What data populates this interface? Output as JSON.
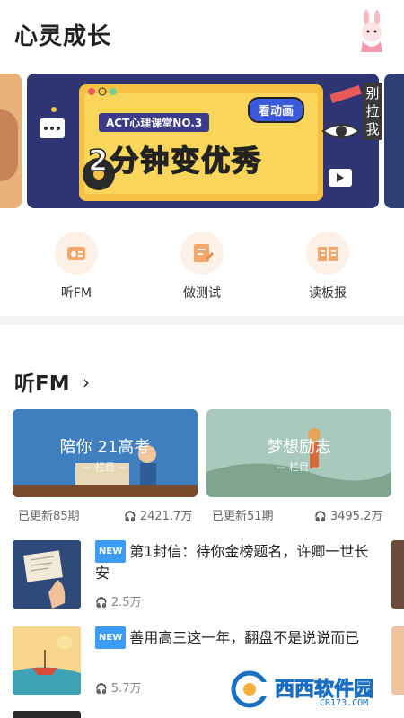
{
  "page": {
    "title": "心灵成长"
  },
  "banner": {
    "course_label": "ACT心理课堂NO.3",
    "watch_label": "看动画",
    "headline": "2分钟变优秀",
    "side_tab": "别拉我"
  },
  "quick_actions": [
    {
      "label": "听FM",
      "icon": "radio-icon"
    },
    {
      "label": "做测试",
      "icon": "test-icon"
    },
    {
      "label": "读板报",
      "icon": "book-icon"
    }
  ],
  "fm_section": {
    "title": "听FM",
    "cards": [
      {
        "title": "陪你 21高考",
        "sub": "— 栏目 —",
        "updated": "已更新85期",
        "plays": "2421.7万"
      },
      {
        "title": "梦想励志",
        "sub": "— 栏目 —",
        "updated": "已更新51期",
        "plays": "3495.2万"
      }
    ],
    "items": [
      {
        "badge": "NEW",
        "title": "第1封信：待你金榜题名，许卿一世长安",
        "plays": "2.5万"
      },
      {
        "badge": "NEW",
        "title": "善用高三这一年，翻盘不是说说而已",
        "plays": "5.7万"
      }
    ]
  },
  "watermark": {
    "brand": "西西软件园",
    "url": "CR173.COM"
  }
}
